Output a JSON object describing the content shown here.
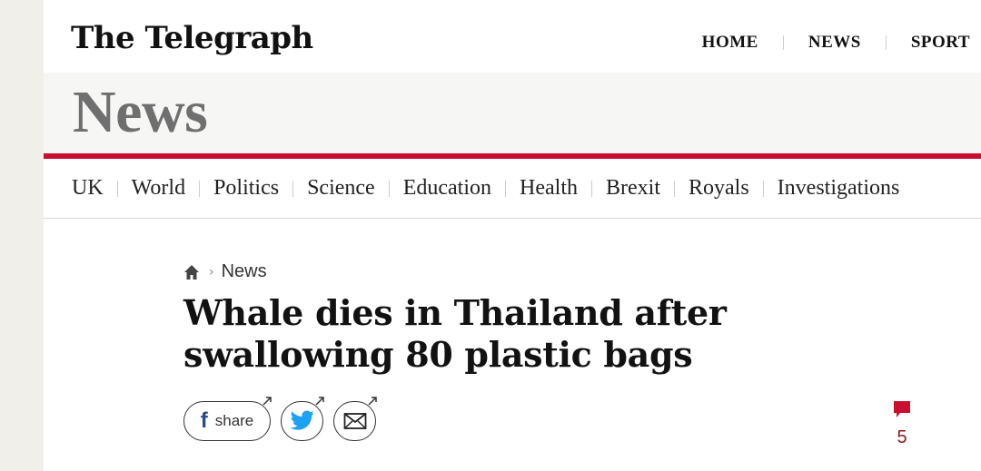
{
  "masthead": {
    "logo": "The Telegraph",
    "nav": [
      {
        "label": "HOME"
      },
      {
        "label": "NEWS"
      },
      {
        "label": "SPORT"
      }
    ]
  },
  "section": {
    "title": "News",
    "accent_color": "#c8102e",
    "nav": [
      {
        "label": "UK"
      },
      {
        "label": "World"
      },
      {
        "label": "Politics"
      },
      {
        "label": "Science"
      },
      {
        "label": "Education"
      },
      {
        "label": "Health"
      },
      {
        "label": "Brexit"
      },
      {
        "label": "Royals"
      },
      {
        "label": "Investigations"
      }
    ]
  },
  "article": {
    "breadcrumb": {
      "home_icon": "home-icon",
      "separator": "›",
      "section": "News"
    },
    "headline": "Whale dies in Thailand after swallowing 80 plastic bags",
    "share": {
      "facebook_label": "share",
      "facebook_icon": "facebook-icon",
      "twitter_icon": "twitter-icon",
      "email_icon": "email-icon",
      "facebook_color": "#2b4a8c",
      "twitter_color": "#1da1f2"
    },
    "comments": {
      "icon": "comment-icon",
      "count": "5",
      "color": "#c8102e"
    }
  }
}
